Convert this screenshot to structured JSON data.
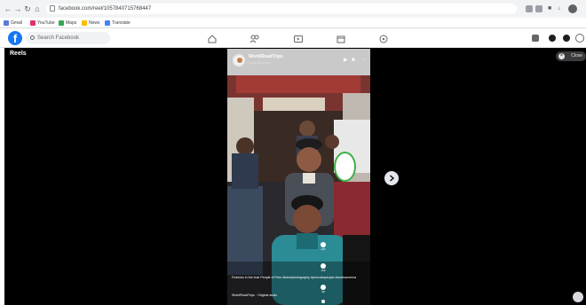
{
  "browser": {
    "url": "facebook.com/reel/1057840715768447",
    "nav_icons": [
      "back-icon",
      "forward-icon",
      "reload-icon",
      "home-icon"
    ],
    "bookmarks": [
      "Gmail",
      "YouTube",
      "Maps",
      "News",
      "Translate"
    ]
  },
  "fb": {
    "logo_letter": "f",
    "search_placeholder": "Search Facebook",
    "nav_icons": [
      "home-icon",
      "friends-icon",
      "watch-icon",
      "marketplace-icon",
      "gaming-icon"
    ]
  },
  "reels": {
    "title": "Reels",
    "close_label": "Close",
    "channel_name": "WorldRoadTrips",
    "channel_sub": "Original audio",
    "caption": "Fearless in the bus! People of Peru #travelphotography #peruvianpeople #southamerica",
    "music": "WorldRoadTrips · Original audio",
    "actions": [
      {
        "icon": "like-icon",
        "count": "12K"
      },
      {
        "icon": "comment-icon",
        "count": "150"
      },
      {
        "icon": "share-icon",
        "count": "98"
      },
      {
        "icon": "more-icon",
        "count": ""
      }
    ]
  },
  "colors": {
    "fb_blue": "#1877f2",
    "viewer_bg": "#000000",
    "marker_border": "#3cb043"
  }
}
